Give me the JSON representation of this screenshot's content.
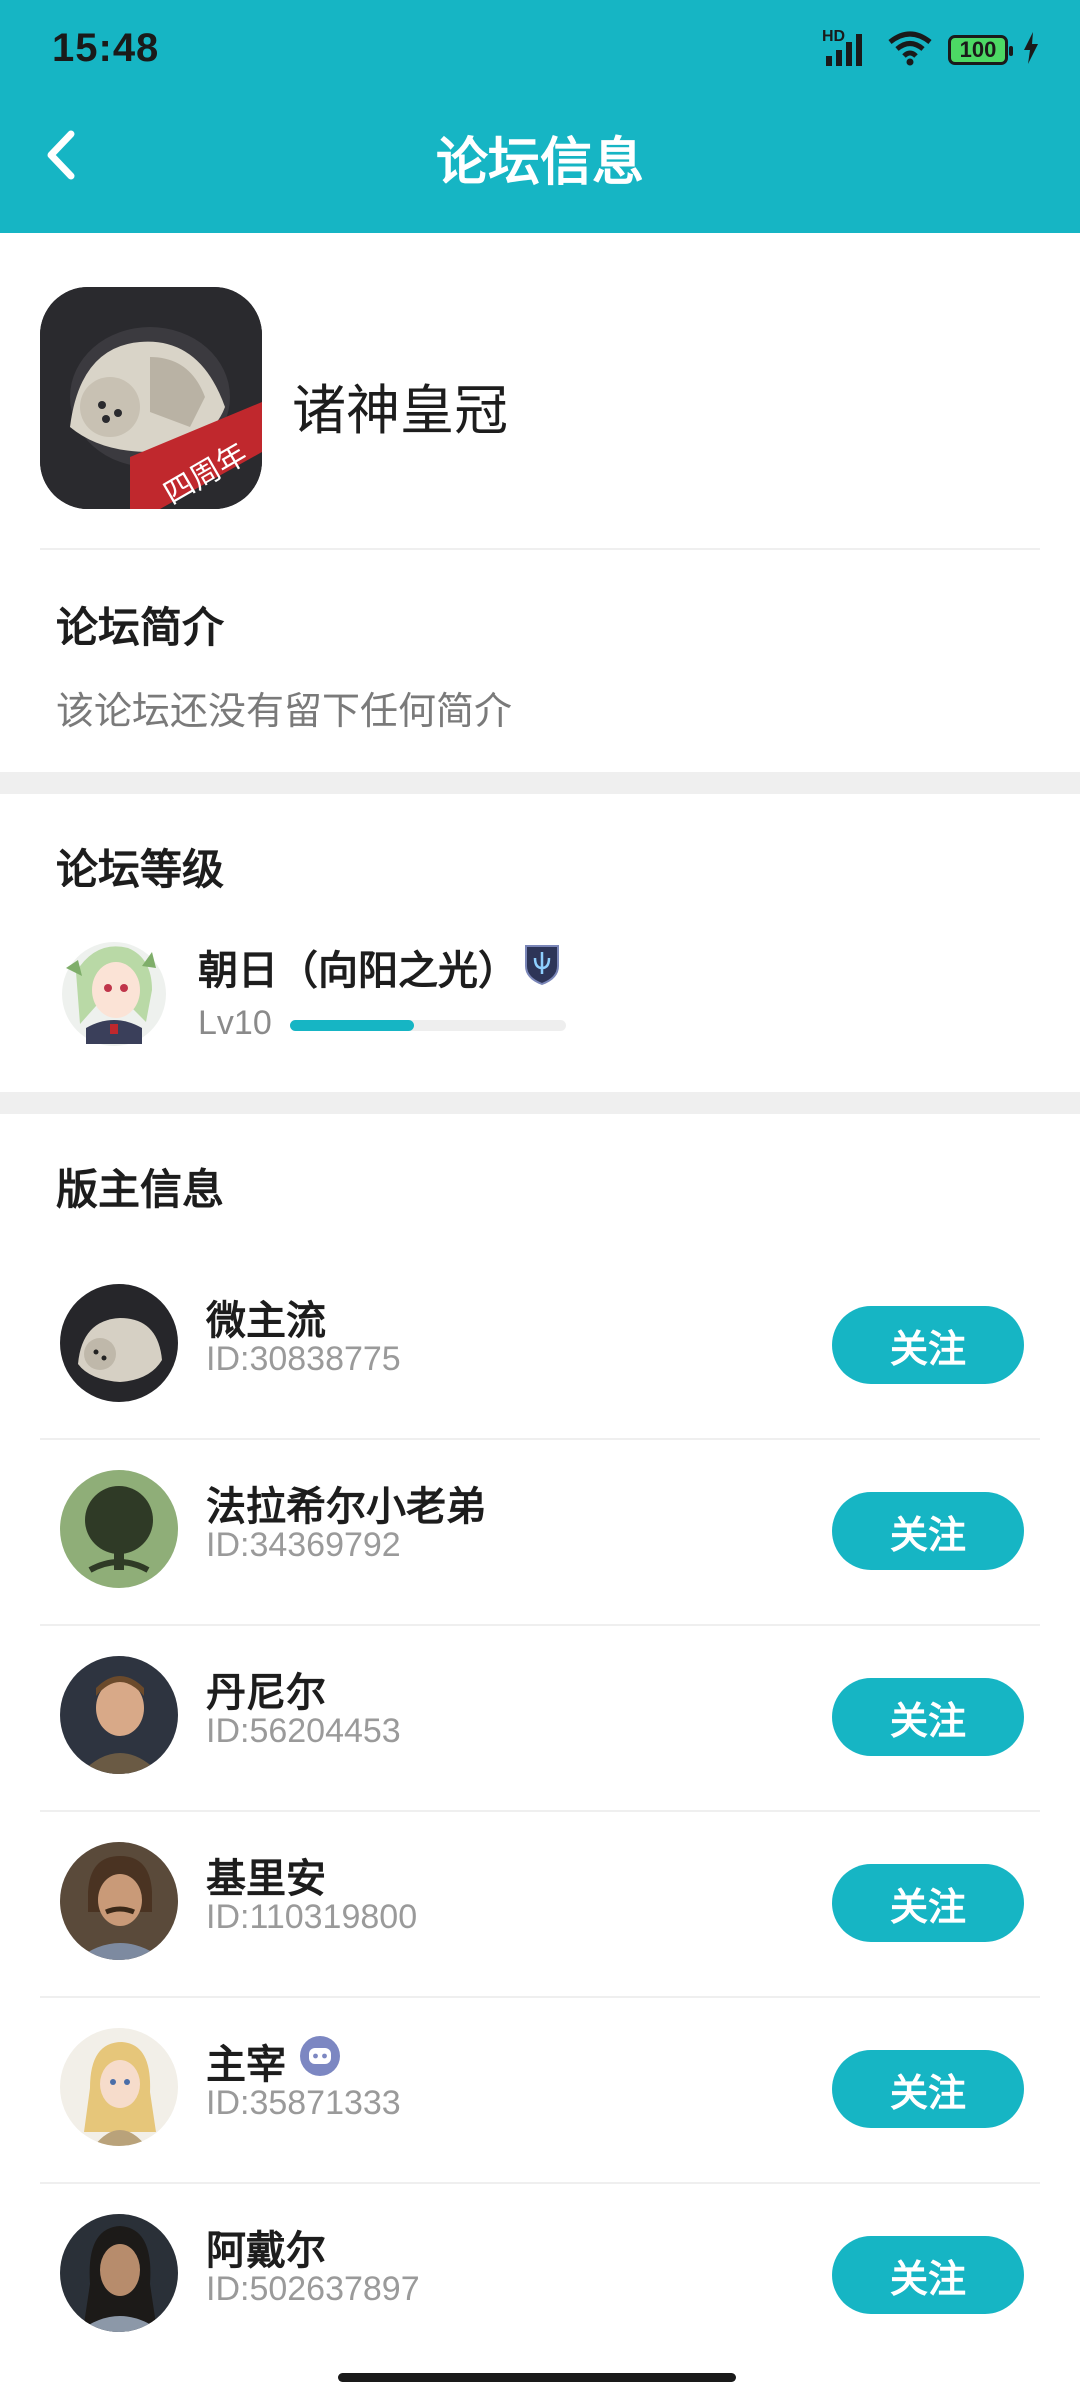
{
  "status_bar": {
    "time": "15:48",
    "network": "HD",
    "battery": "100"
  },
  "header": {
    "title": "论坛信息"
  },
  "forum": {
    "name": "诸神皇冠",
    "icon_ribbon": "四周年"
  },
  "intro": {
    "title": "论坛简介",
    "text": "该论坛还没有留下任何简介"
  },
  "level": {
    "title": "论坛等级",
    "name": "朝日（向阳之光）",
    "lv": "Lv10",
    "progress": 0.45
  },
  "moderators": {
    "title": "版主信息",
    "follow_label": "关注",
    "items": [
      {
        "name": "微主流",
        "id": "ID:30838775"
      },
      {
        "name": "法拉希尔小老弟",
        "id": "ID:34369792"
      },
      {
        "name": "丹尼尔",
        "id": "ID:56204453"
      },
      {
        "name": "基里安",
        "id": "ID:110319800"
      },
      {
        "name": "主宰",
        "id": "ID:35871333"
      },
      {
        "name": "阿戴尔",
        "id": "ID:502637897"
      }
    ]
  }
}
